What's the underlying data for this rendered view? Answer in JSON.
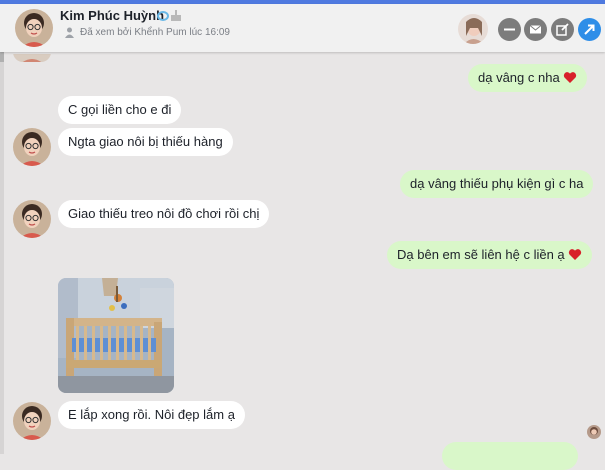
{
  "header": {
    "contact_name": "Kim Phúc Huỳnh",
    "seen_status": "Đã xem bởi Khểnh Pum lúc 16:09",
    "icons": [
      "verified-badge-icon",
      "cake-icon",
      "eye-icon",
      "minimize-icon",
      "mail-icon",
      "compose-icon",
      "share-icon"
    ]
  },
  "messages": [
    {
      "side": "out",
      "text": "dạ vâng c nha",
      "heart": true
    },
    {
      "side": "in",
      "text": "C gọi liền cho e đi"
    },
    {
      "side": "in",
      "text": "Ngta giao nôi bị thiếu hàng"
    },
    {
      "side": "out",
      "text": "dạ vâng thiếu phụ kiện gì c ha"
    },
    {
      "side": "in",
      "text": "Giao thiếu treo nôi đồ chơi rồi chị"
    },
    {
      "side": "out",
      "text": "Dạ bên em sẽ liên hệ c liền ạ",
      "heart": true
    },
    {
      "side": "in",
      "type": "photo",
      "subject": "baby-crib-photo"
    },
    {
      "side": "in",
      "text": "E lắp xong rồi. Nôi đẹp lắm ạ"
    }
  ],
  "colors": {
    "outgoing_bubble": "#d9f7c9",
    "incoming_bubble": "#ffffff",
    "accent": "#2e8ee8",
    "heart": "#d8202a"
  }
}
